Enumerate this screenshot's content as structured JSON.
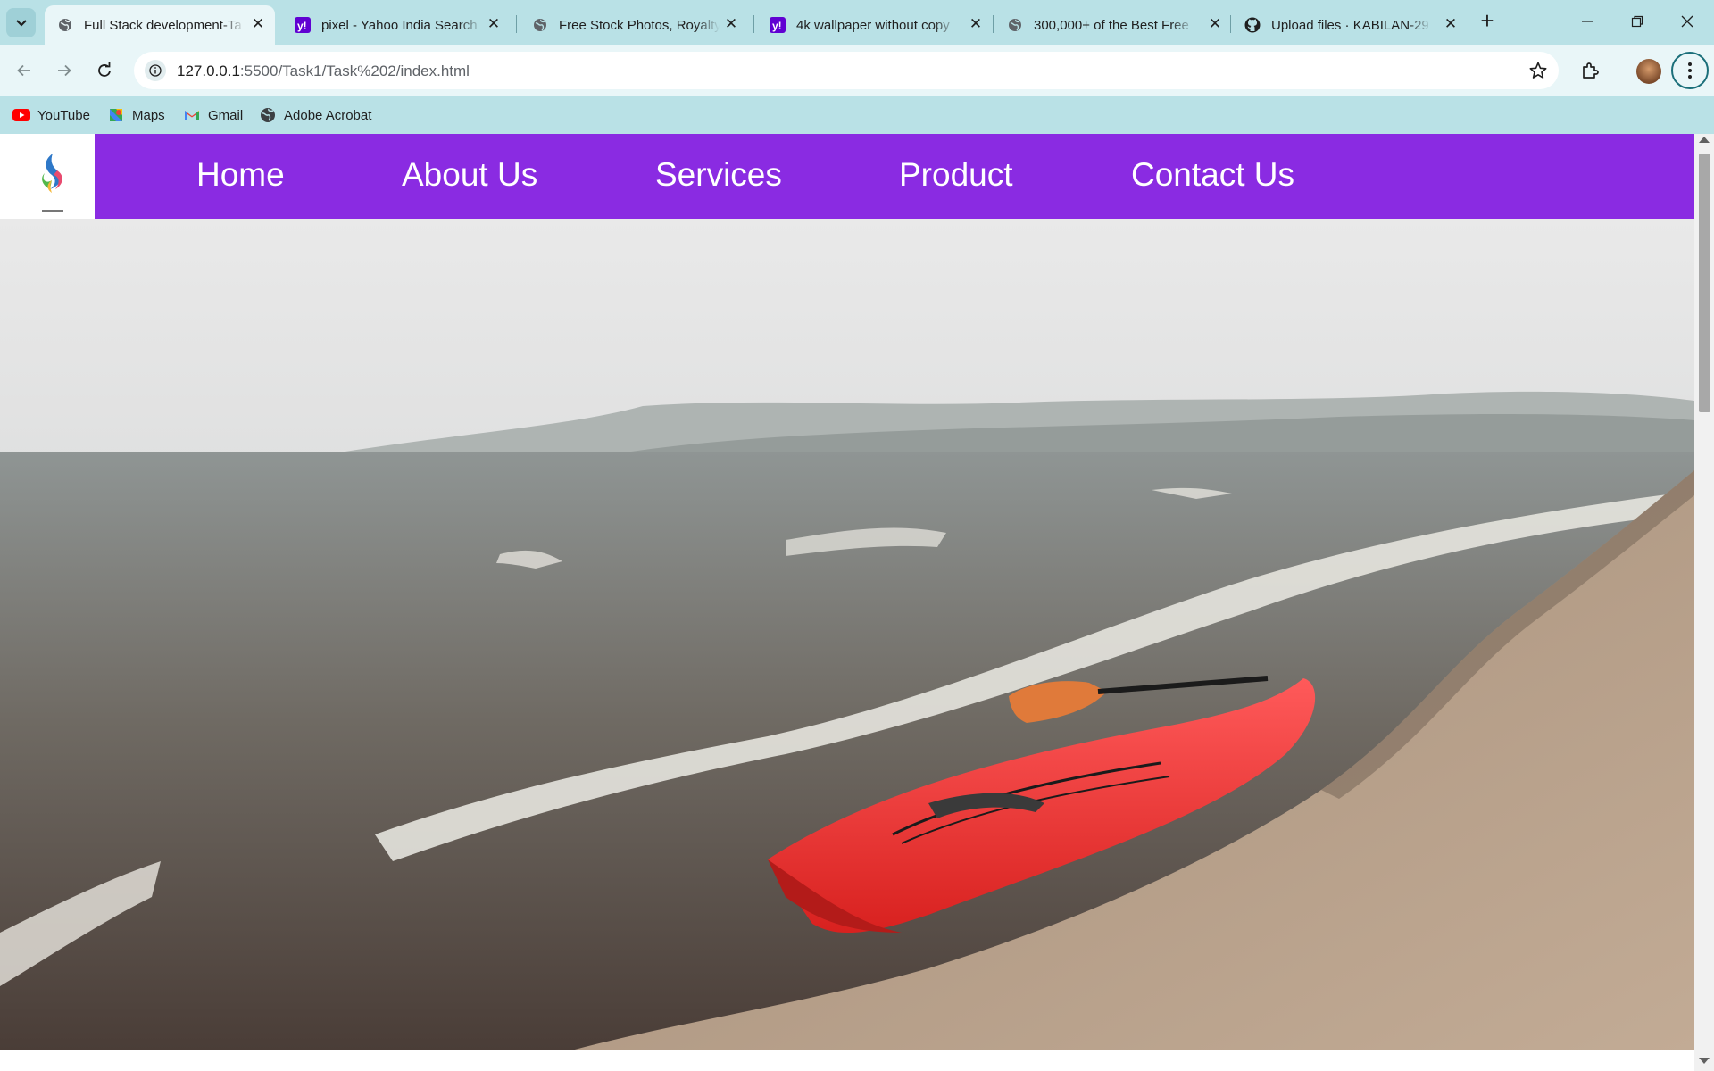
{
  "browser": {
    "tabs": [
      {
        "title": "Full Stack development-Ta",
        "favicon": "globe-icon",
        "active": true
      },
      {
        "title": "pixel - Yahoo India Search",
        "favicon": "yahoo-icon",
        "active": false
      },
      {
        "title": "Free Stock Photos, Royalty",
        "favicon": "globe-icon",
        "active": false
      },
      {
        "title": "4k wallpaper without copy",
        "favicon": "yahoo-icon",
        "active": false
      },
      {
        "title": "300,000+ of the Best Free",
        "favicon": "globe-icon",
        "active": false
      },
      {
        "title": "Upload files · KABILAN-29",
        "favicon": "github-icon",
        "active": false
      }
    ],
    "url": {
      "host": "127.0.0.1",
      "path": ":5500/Task1/Task%202/index.html"
    },
    "bookmarks": [
      {
        "label": "YouTube",
        "icon": "youtube-icon"
      },
      {
        "label": "Maps",
        "icon": "maps-icon"
      },
      {
        "label": "Gmail",
        "icon": "gmail-icon"
      },
      {
        "label": "Adobe Acrobat",
        "icon": "acrobat-icon"
      }
    ]
  },
  "site": {
    "nav_color": "#8a2be2",
    "logo": "brand-logo-icon",
    "nav": {
      "home": "Home",
      "about": "About Us",
      "services": "Services",
      "product": "Product",
      "contact": "Contact Us"
    },
    "hero": {
      "image": "red-kayak-on-foggy-beach"
    }
  }
}
